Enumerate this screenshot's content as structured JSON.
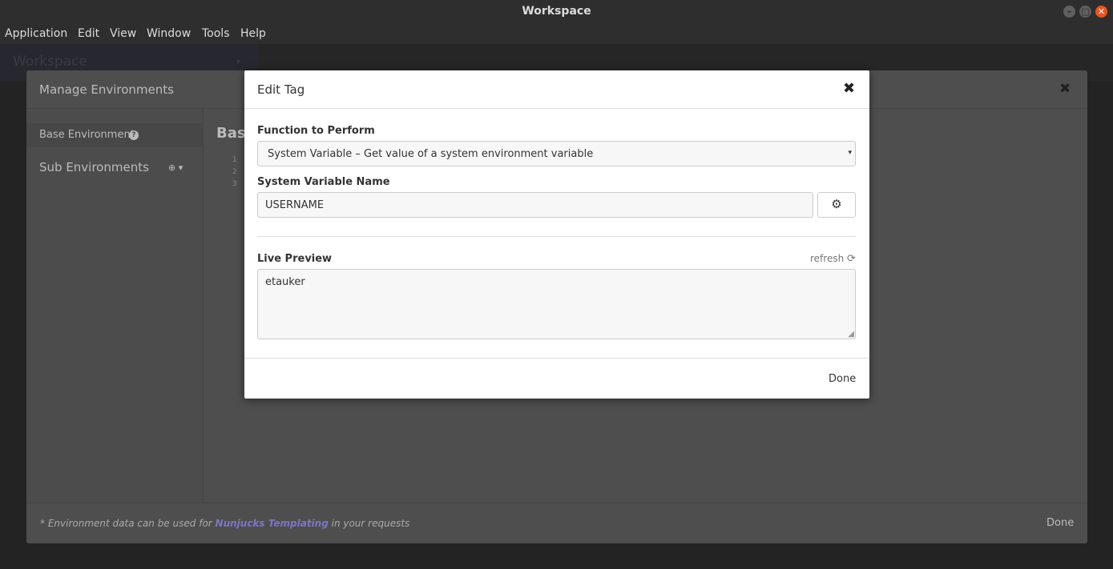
{
  "window": {
    "title": "Workspace",
    "controls": {
      "minimize": "–",
      "maximize": "□",
      "close": "✕"
    }
  },
  "menu": [
    "Application",
    "Edit",
    "View",
    "Window",
    "Tools",
    "Help"
  ],
  "workspace": {
    "name": "Workspace",
    "caret": "▾"
  },
  "environments_modal": {
    "title": "Manage Environments",
    "close": "✖",
    "sidebar": {
      "base_label": "Base Environment",
      "help": "?",
      "sub_label": "Sub Environments",
      "add": "⊕ ▾"
    },
    "main_title": "Base",
    "line_numbers": [
      "1",
      "2",
      "3"
    ],
    "footer": {
      "note_prefix": "* Environment data can be used for ",
      "note_link": "Nunjucks Templating",
      "note_suffix": " in your requests",
      "done": "Done"
    }
  },
  "edit_tag_modal": {
    "title": "Edit Tag",
    "close": "✖",
    "function_label": "Function to Perform",
    "function_value": "System Variable – Get value of a system environment variable",
    "select_arrow": "▾",
    "var_name_label": "System Variable Name",
    "var_name_value": "USERNAME",
    "gear": "⚙",
    "live_preview_label": "Live Preview",
    "refresh_label": "refresh",
    "refresh_icon": "⟳",
    "preview_value": "etauker",
    "resize_grip": "◢",
    "done": "Done"
  },
  "colors": {
    "accent_link": "#7a76c6",
    "close_button": "#e95420",
    "modal_bg": "#ffffff"
  },
  "icons": [
    "minimize-icon",
    "maximize-icon",
    "close-icon",
    "help-icon",
    "add-icon",
    "chevron-down-icon",
    "gear-icon",
    "refresh-icon"
  ]
}
